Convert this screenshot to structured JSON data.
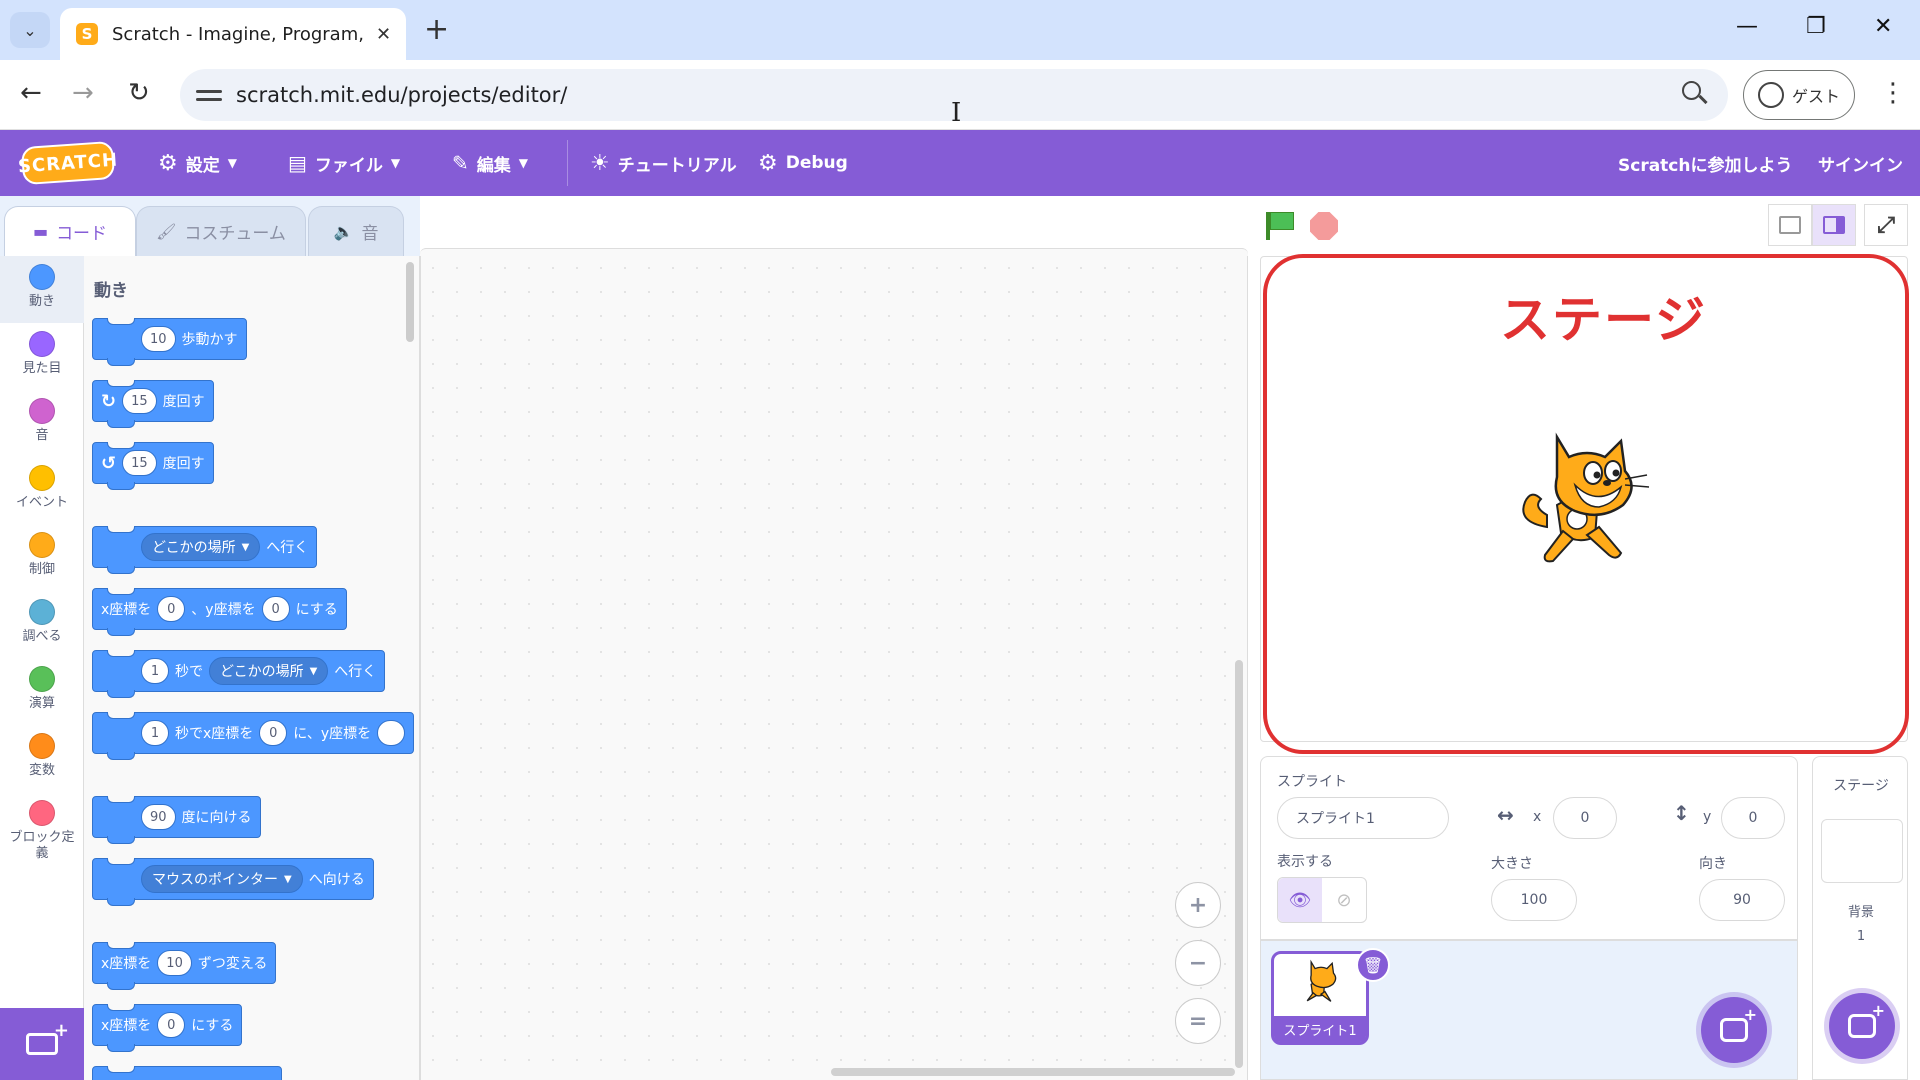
{
  "browser": {
    "tab_title": "Scratch - Imagine, Program, Share",
    "new_tab": "+",
    "url": "scratch.mit.edu/projects/editor/",
    "profile": "ゲスト",
    "window": {
      "minimize": "—",
      "restore": "❐",
      "close": "✕"
    }
  },
  "menubar": {
    "logo": "SCRATCH",
    "settings": "設定",
    "file": "ファイル",
    "edit": "編集",
    "tutorials": "チュートリアル",
    "debug": "Debug",
    "join": "Scratchに参加しよう",
    "signin": "サインイン"
  },
  "tabs": {
    "code": "コード",
    "costumes": "コスチューム",
    "sounds": "音"
  },
  "categories": [
    {
      "label": "動き",
      "color": "#4c97ff"
    },
    {
      "label": "見た目",
      "color": "#9966ff"
    },
    {
      "label": "音",
      "color": "#cf63cf"
    },
    {
      "label": "イベント",
      "color": "#ffbf00"
    },
    {
      "label": "制御",
      "color": "#ffab19"
    },
    {
      "label": "調べる",
      "color": "#5cb1d6"
    },
    {
      "label": "演算",
      "color": "#59c059"
    },
    {
      "label": "変数",
      "color": "#ff8c1a"
    },
    {
      "label": "ブロック定義",
      "color": "#ff6680"
    }
  ],
  "palette": {
    "section": "動き",
    "blocks": {
      "move": {
        "n": "10",
        "t": "歩動かす"
      },
      "turn_right": {
        "n": "15",
        "t": "度回す"
      },
      "turn_left": {
        "n": "15",
        "t": "度回す"
      },
      "goto": {
        "dd": "どこかの場所",
        "t": "へ行く"
      },
      "gotoxy": {
        "a": "x座標を",
        "x": "0",
        "b": "、y座標を",
        "y": "0",
        "c": "にする"
      },
      "glide": {
        "n": "1",
        "a": "秒で",
        "dd": "どこかの場所",
        "b": "へ行く"
      },
      "glidexy": {
        "n": "1",
        "a": "秒でx座標を",
        "x": "0",
        "b": "に、y座標を"
      },
      "point": {
        "n": "90",
        "t": "度に向ける"
      },
      "pointto": {
        "dd": "マウスのポインター",
        "t": "へ向ける"
      },
      "changex": {
        "a": "x座標を",
        "n": "10",
        "b": "ずつ変える"
      },
      "setx": {
        "a": "x座標を",
        "n": "0",
        "b": "にする"
      }
    }
  },
  "zoom": {
    "in": "+",
    "out": "−",
    "reset": "="
  },
  "stage": {
    "annotation": "ステージ"
  },
  "sprite_info": {
    "title": "スプライト",
    "name": "スプライト1",
    "x_label": "x",
    "x": "0",
    "y_label": "y",
    "y": "0",
    "show_label": "表示する",
    "size_label": "大きさ",
    "size": "100",
    "direction_label": "向き",
    "direction": "90"
  },
  "sprites": [
    {
      "name": "スプライト1"
    }
  ],
  "stage_pane": {
    "title": "ステージ",
    "backdrop_label": "背景",
    "backdrop_count": "1"
  },
  "colors": {
    "accent": "#855cd6",
    "motion": "#4c97ff",
    "annotation": "#e03131"
  }
}
